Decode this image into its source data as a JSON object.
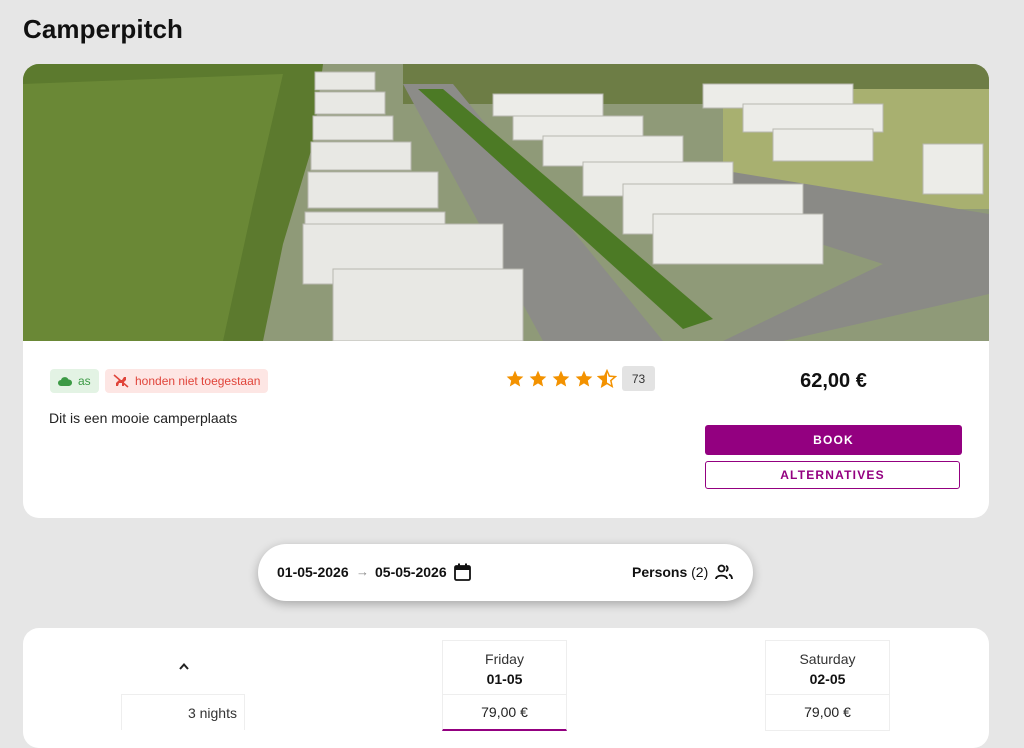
{
  "page": {
    "title": "Camperpitch"
  },
  "listing": {
    "image_alt": "Camper vans parked on a campsite",
    "tags": [
      {
        "icon": "cloud-icon",
        "label": "as",
        "color": "#3c9a45"
      },
      {
        "icon": "no-dogs-icon",
        "label": "honden niet toegestaan",
        "color": "#e0443a"
      }
    ],
    "description": "Dit is een mooie camperplaats",
    "rating": {
      "stars": 4.5,
      "max": 5,
      "count": "73",
      "star_color": "#f39200"
    },
    "price": "62,00 €",
    "book_label": "BOOK",
    "alternatives_label": "ALTERNATIVES",
    "accent_color": "#930080"
  },
  "search": {
    "date_from": "01-05-2026",
    "arrow": "→",
    "date_to": "05-05-2026",
    "persons_label": "Persons",
    "persons_count": "(2)"
  },
  "availability": {
    "nights_label": "3 nights",
    "days": [
      {
        "weekday": "Friday",
        "date": "01-05",
        "price": "79,00 €",
        "selected": true
      },
      {
        "weekday": "Saturday",
        "date": "02-05",
        "price": "79,00 €",
        "selected": false
      }
    ]
  }
}
